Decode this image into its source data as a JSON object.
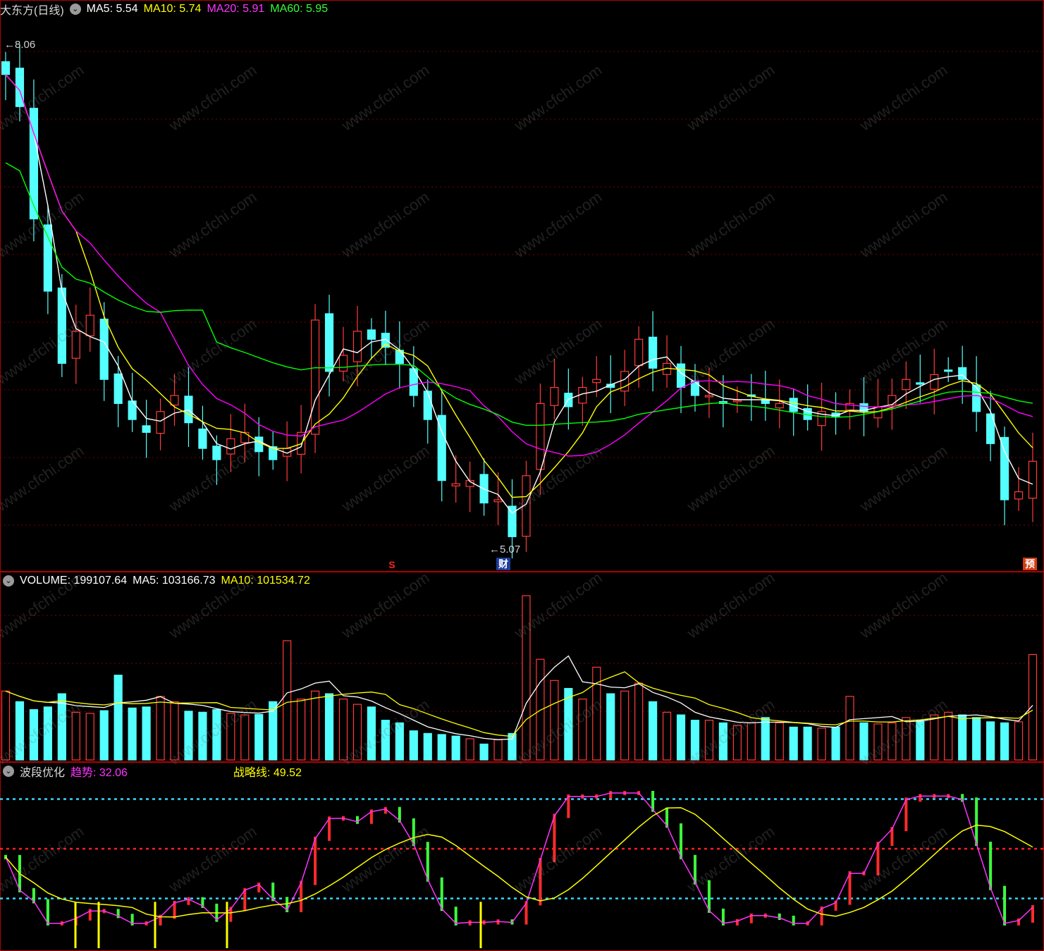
{
  "header": {
    "stock_name": "大东方(日线)",
    "ma5_label": "MA5: 5.54",
    "ma10_label": "MA10: 5.74",
    "ma20_label": "MA20: 5.91",
    "ma60_label": "MA60: 5.95"
  },
  "volume_header": {
    "volume_label": "VOLUME: 199107.64",
    "ma5_label": "MA5: 103166.73",
    "ma10_label": "MA10: 101534.72"
  },
  "indicator_header": {
    "name": "波段优化",
    "trend_label": "趋势: 32.06",
    "strategy_label": "战略线: 49.52"
  },
  "annotations": {
    "high_label": "8.06",
    "low_label": "5.07",
    "marker_s": "S",
    "marker_cai": "财",
    "marker_yu": "预"
  },
  "watermark": "www.cfchi.com",
  "colors": {
    "up": "#ff3b3b",
    "down": "#54ffff",
    "ma5": "#ffffff",
    "ma10": "#ffff00",
    "ma20": "#ff00ff",
    "ma60": "#00ff00",
    "grid": "#7a0000",
    "border": "#b00000"
  },
  "chart_data": [
    {
      "type": "candlestick",
      "title": "大东方(日线)",
      "ylim": [
        4.9,
        8.3
      ],
      "points": {
        "high": 8.06,
        "low": 5.07
      },
      "close_path": [
        7.95,
        7.75,
        7.05,
        6.6,
        6.15,
        6.35,
        6.45,
        6.05,
        5.9,
        5.8,
        5.72,
        5.85,
        5.95,
        5.78,
        5.62,
        5.55,
        5.68,
        5.72,
        5.6,
        5.55,
        5.62,
        5.72,
        6.42,
        6.1,
        6.2,
        6.35,
        6.3,
        6.25,
        6.15,
        5.95,
        5.8,
        5.42,
        5.4,
        5.42,
        5.28,
        5.3,
        5.07,
        5.45,
        5.9,
        6.0,
        5.88,
        6.0,
        6.05,
        6.0,
        6.1,
        6.3,
        6.12,
        6.15,
        6.0,
        5.95,
        5.95,
        5.9,
        5.92,
        5.95,
        5.9,
        5.9,
        5.85,
        5.8,
        5.85,
        5.82,
        5.9,
        5.85,
        5.88,
        5.95,
        6.05,
        6.02,
        6.08,
        6.1,
        6.05,
        5.85,
        5.65,
        5.3,
        5.35,
        5.54
      ],
      "ma5_last": 5.54,
      "ma10_last": 5.74,
      "ma20_last": 5.91,
      "ma60_last": 5.95
    },
    {
      "type": "bar",
      "title": "VOLUME",
      "values_k": [
        130,
        110,
        95,
        100,
        125,
        90,
        88,
        93,
        160,
        98,
        100,
        120,
        110,
        92,
        90,
        95,
        88,
        85,
        86,
        110,
        225,
        115,
        130,
        125,
        115,
        105,
        100,
        75,
        70,
        55,
        50,
        48,
        45,
        40,
        30,
        38,
        50,
        310,
        190,
        150,
        135,
        115,
        175,
        125,
        130,
        145,
        110,
        90,
        85,
        75,
        75,
        70,
        65,
        70,
        80,
        70,
        62,
        62,
        60,
        62,
        120,
        70,
        68,
        70,
        80,
        75,
        85,
        90,
        85,
        80,
        72,
        70,
        72,
        199
      ],
      "ma5_last": 103166.73,
      "ma10_last": 101534.72,
      "last": 199107.64
    },
    {
      "type": "line",
      "title": "波段优化",
      "series": [
        {
          "name": "趋势",
          "last": 32.06
        },
        {
          "name": "战略线",
          "last": 49.52
        }
      ]
    }
  ]
}
